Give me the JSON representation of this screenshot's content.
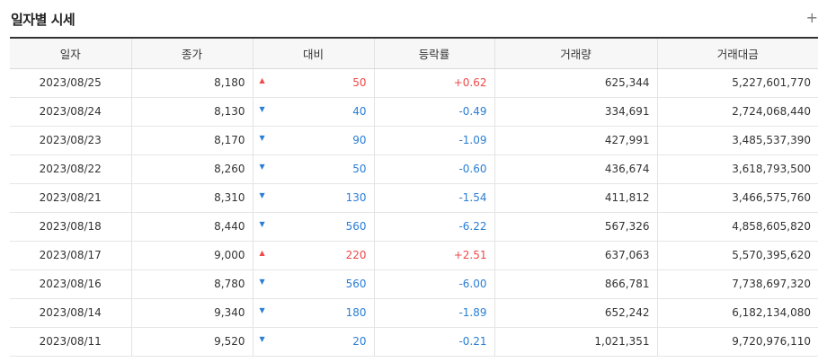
{
  "title": "일자별 시세",
  "more_label": "+",
  "colors": {
    "up": "#f04848",
    "down": "#2a7ed6"
  },
  "headers": [
    "일자",
    "종가",
    "대비",
    "등락률",
    "거래량",
    "거래대금"
  ],
  "rows": [
    {
      "date": "2023/08/25",
      "close": "8,180",
      "dir": "up",
      "arrow": "▲",
      "change": "50",
      "rate": "+0.62",
      "volume": "625,344",
      "amount": "5,227,601,770"
    },
    {
      "date": "2023/08/24",
      "close": "8,130",
      "dir": "down",
      "arrow": "▼",
      "change": "40",
      "rate": "-0.49",
      "volume": "334,691",
      "amount": "2,724,068,440"
    },
    {
      "date": "2023/08/23",
      "close": "8,170",
      "dir": "down",
      "arrow": "▼",
      "change": "90",
      "rate": "-1.09",
      "volume": "427,991",
      "amount": "3,485,537,390"
    },
    {
      "date": "2023/08/22",
      "close": "8,260",
      "dir": "down",
      "arrow": "▼",
      "change": "50",
      "rate": "-0.60",
      "volume": "436,674",
      "amount": "3,618,793,500"
    },
    {
      "date": "2023/08/21",
      "close": "8,310",
      "dir": "down",
      "arrow": "▼",
      "change": "130",
      "rate": "-1.54",
      "volume": "411,812",
      "amount": "3,466,575,760"
    },
    {
      "date": "2023/08/18",
      "close": "8,440",
      "dir": "down",
      "arrow": "▼",
      "change": "560",
      "rate": "-6.22",
      "volume": "567,326",
      "amount": "4,858,605,820"
    },
    {
      "date": "2023/08/17",
      "close": "9,000",
      "dir": "up",
      "arrow": "▲",
      "change": "220",
      "rate": "+2.51",
      "volume": "637,063",
      "amount": "5,570,395,620"
    },
    {
      "date": "2023/08/16",
      "close": "8,780",
      "dir": "down",
      "arrow": "▼",
      "change": "560",
      "rate": "-6.00",
      "volume": "866,781",
      "amount": "7,738,697,320"
    },
    {
      "date": "2023/08/14",
      "close": "9,340",
      "dir": "down",
      "arrow": "▼",
      "change": "180",
      "rate": "-1.89",
      "volume": "652,242",
      "amount": "6,182,134,080"
    },
    {
      "date": "2023/08/11",
      "close": "9,520",
      "dir": "down",
      "arrow": "▼",
      "change": "20",
      "rate": "-0.21",
      "volume": "1,021,351",
      "amount": "9,720,976,110"
    }
  ]
}
